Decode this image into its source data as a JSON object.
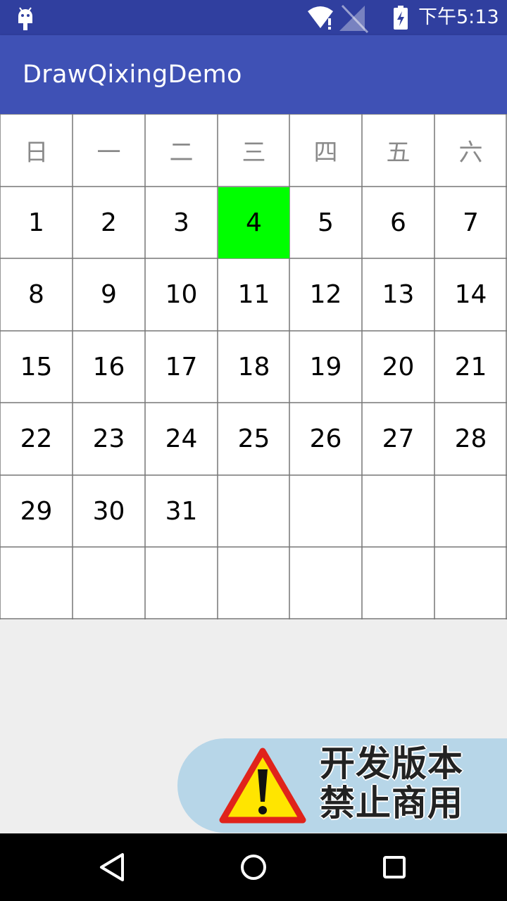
{
  "status_bar": {
    "time": "下午5:13",
    "icons": [
      "android-icon",
      "wifi-icon",
      "signal-icon",
      "battery-icon"
    ]
  },
  "app_bar": {
    "title": "DrawQixingDemo"
  },
  "calendar": {
    "weekdays": [
      "日",
      "一",
      "二",
      "三",
      "四",
      "五",
      "六"
    ],
    "rows": [
      [
        "1",
        "2",
        "3",
        "4",
        "5",
        "6",
        "7"
      ],
      [
        "8",
        "9",
        "10",
        "11",
        "12",
        "13",
        "14"
      ],
      [
        "15",
        "16",
        "17",
        "18",
        "19",
        "20",
        "21"
      ],
      [
        "22",
        "23",
        "24",
        "25",
        "26",
        "27",
        "28"
      ],
      [
        "29",
        "30",
        "31",
        "",
        "",
        "",
        ""
      ],
      [
        "",
        "",
        "",
        "",
        "",
        "",
        ""
      ]
    ],
    "highlighted_day": "4",
    "highlight_color": "#00ff00",
    "grid_color": "#777777"
  },
  "badge": {
    "line1": "开发版本",
    "line2": "禁止商用",
    "icon": "warning-icon"
  },
  "nav_bar": {
    "buttons": [
      "back-icon",
      "home-icon",
      "recents-icon"
    ]
  },
  "colors": {
    "status_bar": "#303f9f",
    "app_bar": "#3f51b5",
    "background": "#eeeeee"
  }
}
